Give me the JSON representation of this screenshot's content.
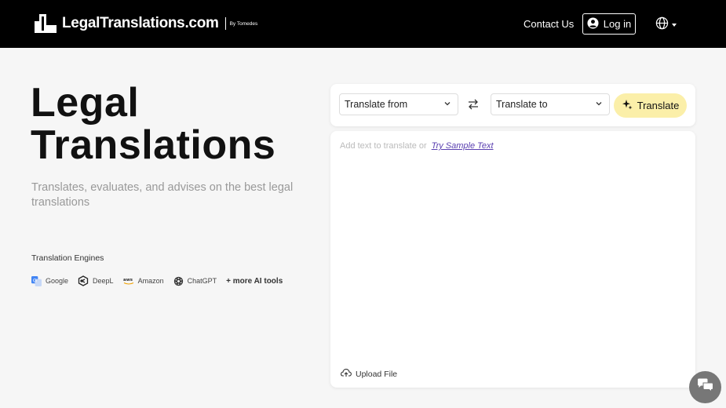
{
  "header": {
    "logo_text": "LegalTranslations.com",
    "logo_by": "By Tomedes",
    "contact_label": "Contact Us",
    "login_label": "Log in",
    "icons": {
      "logo": "logo-mark",
      "user": "user-circle-icon",
      "globe": "globe-icon",
      "caret": "caret-down-icon"
    }
  },
  "hero": {
    "title_line1": "Legal",
    "title_line2": "Translations",
    "subtitle": "Translates, evaluates, and advises on the best legal translations",
    "engines_label": "Translation Engines",
    "engines": [
      {
        "name": "Google",
        "icon": "google-translate-icon"
      },
      {
        "name": "DeepL",
        "icon": "deepl-icon"
      },
      {
        "name": "Amazon",
        "icon": "aws-icon"
      },
      {
        "name": "ChatGPT",
        "icon": "chatgpt-icon"
      }
    ],
    "more_tools": "+ more AI tools"
  },
  "translator": {
    "from_label": "Translate from",
    "to_label": "Translate to",
    "translate_label": "Translate",
    "placeholder": "Add text to translate or",
    "sample_link": "Try Sample Text",
    "upload_label": "Upload File"
  },
  "colors": {
    "header_bg": "#000000",
    "page_bg": "#f6f6f6",
    "translate_button": "#fbefa9",
    "sample_link": "#5a3fb0",
    "chat_bubble": "#777777"
  }
}
